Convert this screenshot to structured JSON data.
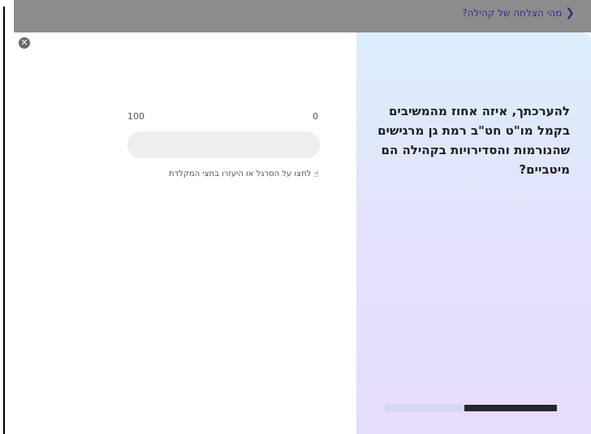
{
  "top_bar": {
    "breadcrumb": "מהי הצלחה של קהילה?"
  },
  "question": {
    "text": "להערכתך, איזה אחוז מהמשיבים בקמל מו\"ט חט\"ב רמת גן מרגישים שהנורמות והסדירויות בקהילה הם מיטביים?"
  },
  "slider": {
    "min_label": "0",
    "max_label": "100",
    "hint": "לחצו על הסרגל או היעזרו בחצי המקלדת"
  },
  "progress": {
    "fraction": 0.54
  },
  "colors": {
    "panel_top": "#dceefe",
    "panel_bottom": "#e6dcfb",
    "progress_fill": "#26262c",
    "progress_track": "#d5d8ee",
    "link": "#2f2f8a"
  },
  "icons": {
    "close": "close-icon",
    "back": "chevron-right-icon",
    "hint": "pointer-hand-icon"
  }
}
